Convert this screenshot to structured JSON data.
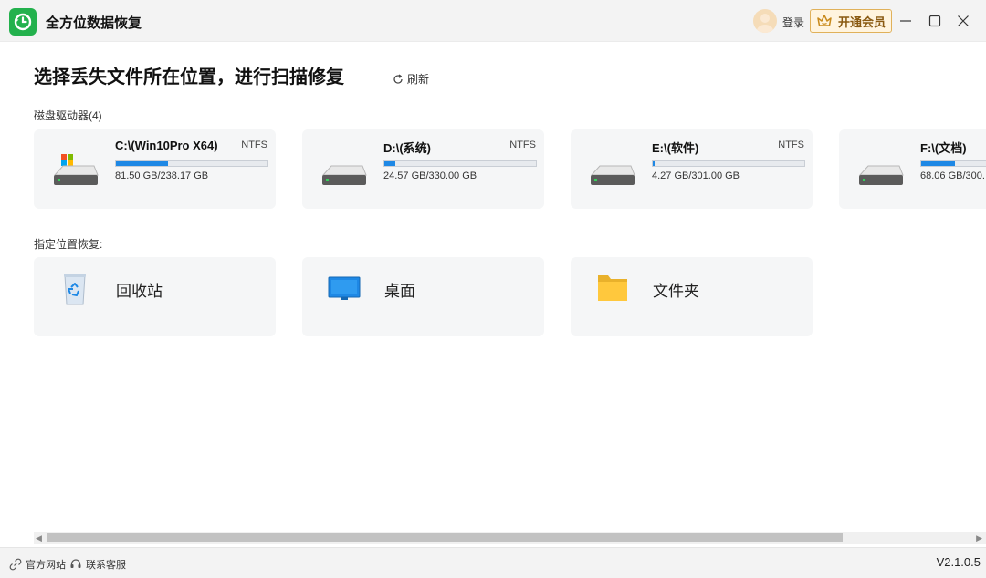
{
  "app": {
    "title": "全方位数据恢复"
  },
  "header": {
    "login_label": "登录",
    "vip_label": "开通会员"
  },
  "main": {
    "title": "选择丢失文件所在位置，进行扫描修复",
    "refresh_label": "刷新",
    "drives_section_label": "磁盘驱动器(4)",
    "locations_section_label": "指定位置恢复:"
  },
  "drives": [
    {
      "name": "C:\\(Win10Pro X64)",
      "fs": "NTFS",
      "size": "81.50 GB/238.17 GB",
      "used_fraction": 0.342,
      "icon": "windows-drive-icon"
    },
    {
      "name": "D:\\(系统)",
      "fs": "NTFS",
      "size": "24.57 GB/330.00 GB",
      "used_fraction": 0.074,
      "icon": "hdd-icon"
    },
    {
      "name": "E:\\(软件)",
      "fs": "NTFS",
      "size": "4.27 GB/301.00 GB",
      "used_fraction": 0.014,
      "icon": "hdd-icon"
    },
    {
      "name": "F:\\(文档)",
      "fs": "",
      "size": "68.06 GB/300.",
      "used_fraction": 0.227,
      "icon": "hdd-icon"
    }
  ],
  "locations": [
    {
      "name": "回收站",
      "icon": "recycle-bin-icon"
    },
    {
      "name": "桌面",
      "icon": "desktop-icon"
    },
    {
      "name": "文件夹",
      "icon": "folder-icon"
    }
  ],
  "footer": {
    "website_label": "官方网站",
    "support_label": "联系客服",
    "version": "V2.1.0.5"
  },
  "colors": {
    "brand_green": "#23b14d",
    "progress_blue": "#1e88e5",
    "vip_gold": "#e0b15a"
  }
}
